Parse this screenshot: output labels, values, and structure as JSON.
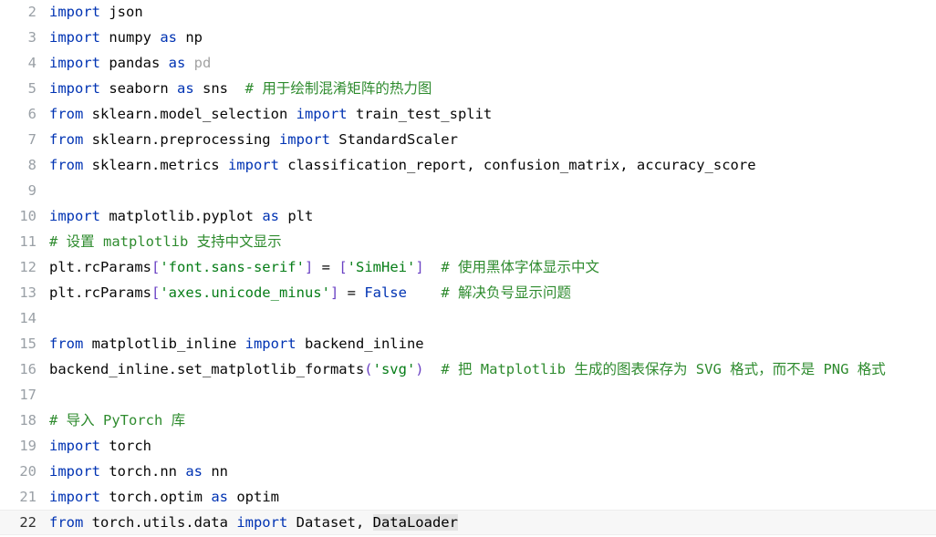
{
  "editor": {
    "current_line": 22,
    "lines": [
      {
        "num": "2",
        "tokens": [
          {
            "t": "import",
            "k": "kw"
          },
          {
            "t": " json",
            "k": "plain"
          }
        ]
      },
      {
        "num": "3",
        "tokens": [
          {
            "t": "import",
            "k": "kw"
          },
          {
            "t": " numpy ",
            "k": "plain"
          },
          {
            "t": "as",
            "k": "kw"
          },
          {
            "t": " np",
            "k": "plain"
          }
        ]
      },
      {
        "num": "4",
        "tokens": [
          {
            "t": "import",
            "k": "kw"
          },
          {
            "t": " pandas ",
            "k": "plain"
          },
          {
            "t": "as",
            "k": "kw"
          },
          {
            "t": " ",
            "k": "plain"
          },
          {
            "t": "pd",
            "k": "unused"
          }
        ]
      },
      {
        "num": "5",
        "tokens": [
          {
            "t": "import",
            "k": "kw"
          },
          {
            "t": " seaborn ",
            "k": "plain"
          },
          {
            "t": "as",
            "k": "kw"
          },
          {
            "t": " sns  ",
            "k": "plain"
          },
          {
            "t": "# 用于绘制混淆矩阵的热力图",
            "k": "comment"
          }
        ]
      },
      {
        "num": "6",
        "tokens": [
          {
            "t": "from",
            "k": "kw"
          },
          {
            "t": " sklearn.model_selection ",
            "k": "plain"
          },
          {
            "t": "import",
            "k": "kw"
          },
          {
            "t": " train_test_split",
            "k": "plain"
          }
        ]
      },
      {
        "num": "7",
        "tokens": [
          {
            "t": "from",
            "k": "kw"
          },
          {
            "t": " sklearn.preprocessing ",
            "k": "plain"
          },
          {
            "t": "import",
            "k": "kw"
          },
          {
            "t": " StandardScaler",
            "k": "plain"
          }
        ]
      },
      {
        "num": "8",
        "tokens": [
          {
            "t": "from",
            "k": "kw"
          },
          {
            "t": " sklearn.metrics ",
            "k": "plain"
          },
          {
            "t": "import",
            "k": "kw"
          },
          {
            "t": " classification_report, confusion_matrix, accuracy_score",
            "k": "plain"
          }
        ]
      },
      {
        "num": "9",
        "tokens": []
      },
      {
        "num": "10",
        "tokens": [
          {
            "t": "import",
            "k": "kw"
          },
          {
            "t": " matplotlib.pyplot ",
            "k": "plain"
          },
          {
            "t": "as",
            "k": "kw"
          },
          {
            "t": " plt",
            "k": "plain"
          }
        ]
      },
      {
        "num": "11",
        "tokens": [
          {
            "t": "# 设置 matplotlib 支持中文显示",
            "k": "comment"
          }
        ]
      },
      {
        "num": "12",
        "tokens": [
          {
            "t": "plt.rcParams",
            "k": "plain"
          },
          {
            "t": "[",
            "k": "bracket"
          },
          {
            "t": "'font.sans-serif'",
            "k": "string"
          },
          {
            "t": "]",
            "k": "bracket"
          },
          {
            "t": " = ",
            "k": "plain"
          },
          {
            "t": "[",
            "k": "bracket"
          },
          {
            "t": "'SimHei'",
            "k": "string"
          },
          {
            "t": "]",
            "k": "bracket"
          },
          {
            "t": "  ",
            "k": "plain"
          },
          {
            "t": "# 使用黑体字体显示中文",
            "k": "comment"
          }
        ]
      },
      {
        "num": "13",
        "tokens": [
          {
            "t": "plt.rcParams",
            "k": "plain"
          },
          {
            "t": "[",
            "k": "bracket"
          },
          {
            "t": "'axes.unicode_minus'",
            "k": "string"
          },
          {
            "t": "]",
            "k": "bracket"
          },
          {
            "t": " = ",
            "k": "plain"
          },
          {
            "t": "False",
            "k": "kw"
          },
          {
            "t": "    ",
            "k": "plain"
          },
          {
            "t": "# 解决负号显示问题",
            "k": "comment"
          }
        ]
      },
      {
        "num": "14",
        "tokens": []
      },
      {
        "num": "15",
        "tokens": [
          {
            "t": "from",
            "k": "kw"
          },
          {
            "t": " matplotlib_inline ",
            "k": "plain"
          },
          {
            "t": "import",
            "k": "kw"
          },
          {
            "t": " backend_inline",
            "k": "plain"
          }
        ]
      },
      {
        "num": "16",
        "tokens": [
          {
            "t": "backend_inline.set_matplotlib_formats",
            "k": "plain"
          },
          {
            "t": "(",
            "k": "bracket"
          },
          {
            "t": "'svg'",
            "k": "string"
          },
          {
            "t": ")",
            "k": "bracket"
          },
          {
            "t": "  ",
            "k": "plain"
          },
          {
            "t": "# 把 Matplotlib 生成的图表保存为 SVG 格式，而不是 PNG 格式",
            "k": "comment"
          }
        ]
      },
      {
        "num": "17",
        "tokens": []
      },
      {
        "num": "18",
        "tokens": [
          {
            "t": "# 导入 PyTorch 库",
            "k": "comment"
          }
        ]
      },
      {
        "num": "19",
        "tokens": [
          {
            "t": "import",
            "k": "kw"
          },
          {
            "t": " torch",
            "k": "plain"
          }
        ]
      },
      {
        "num": "20",
        "tokens": [
          {
            "t": "import",
            "k": "kw"
          },
          {
            "t": " torch.nn ",
            "k": "plain"
          },
          {
            "t": "as",
            "k": "kw"
          },
          {
            "t": " nn",
            "k": "plain"
          }
        ]
      },
      {
        "num": "21",
        "tokens": [
          {
            "t": "import",
            "k": "kw"
          },
          {
            "t": " torch.optim ",
            "k": "plain"
          },
          {
            "t": "as",
            "k": "kw"
          },
          {
            "t": " optim",
            "k": "plain"
          }
        ]
      },
      {
        "num": "22",
        "tokens": [
          {
            "t": "from",
            "k": "kw"
          },
          {
            "t": " torch.utils.data ",
            "k": "plain"
          },
          {
            "t": "import",
            "k": "kw"
          },
          {
            "t": " Dataset, ",
            "k": "plain"
          },
          {
            "t": "DataLoader",
            "k": "hl"
          }
        ]
      }
    ]
  }
}
